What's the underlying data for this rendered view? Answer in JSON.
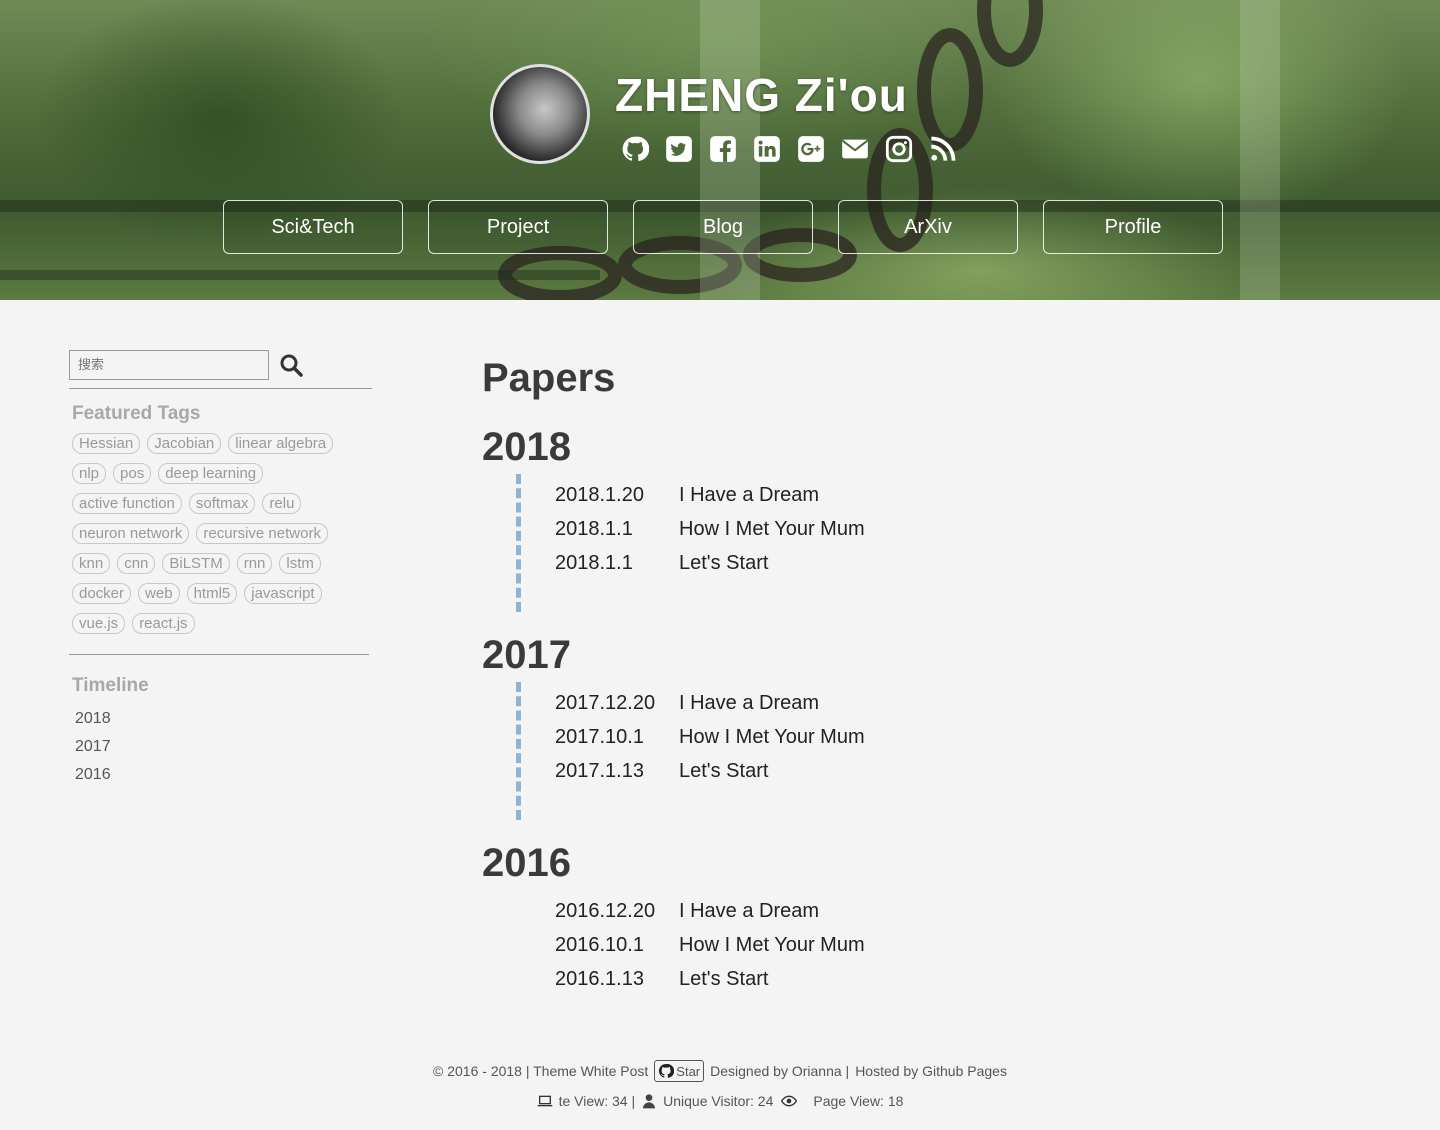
{
  "header": {
    "site_title": "ZHENG Zi'ou",
    "social_icons": [
      "github-icon",
      "twitter-icon",
      "facebook-icon",
      "linkedin-icon",
      "google-plus-icon",
      "email-icon",
      "instagram-icon",
      "rss-icon"
    ],
    "nav": [
      "Sci&Tech",
      "Project",
      "Blog",
      "ArXiv",
      "Profile"
    ]
  },
  "sidebar": {
    "search_placeholder": "搜索",
    "featured_tags_title": "Featured Tags",
    "tags": [
      "Hessian",
      "Jacobian",
      "linear algebra",
      "nlp",
      "pos",
      "deep learning",
      "active function",
      "softmax",
      "relu",
      "neuron network",
      "recursive network",
      "knn",
      "cnn",
      "BiLSTM",
      "rnn",
      "lstm",
      "docker",
      "web",
      "html5",
      "javascript",
      "vue.js",
      "react.js"
    ],
    "timeline_title": "Timeline",
    "timeline": [
      "2018",
      "2017",
      "2016"
    ]
  },
  "main": {
    "title": "Papers",
    "years": [
      {
        "year": "2018",
        "posts": [
          {
            "date": "2018.1.20",
            "title": "I Have a Dream"
          },
          {
            "date": "2018.1.1",
            "title": "How I Met Your Mum"
          },
          {
            "date": "2018.1.1",
            "title": "Let's Start"
          }
        ]
      },
      {
        "year": "2017",
        "posts": [
          {
            "date": "2017.12.20",
            "title": "I Have a Dream"
          },
          {
            "date": "2017.10.1",
            "title": "How I Met Your Mum"
          },
          {
            "date": "2017.1.13",
            "title": "Let's Start"
          }
        ]
      },
      {
        "year": "2016",
        "posts": [
          {
            "date": "2016.12.20",
            "title": "I Have a Dream"
          },
          {
            "date": "2016.10.1",
            "title": "How I Met Your Mum"
          },
          {
            "date": "2016.1.13",
            "title": "Let's Start"
          }
        ]
      }
    ]
  },
  "footer": {
    "copyright": "© 2016 - 2018 | Theme White Post",
    "star_label": "Star",
    "designed_by": "Designed by Orianna |",
    "hosted_by": "Hosted by Github Pages",
    "site_view": "te View: 34 |",
    "unique_visitor": "Unique Visitor: 24",
    "page_view": "Page View: 18"
  }
}
